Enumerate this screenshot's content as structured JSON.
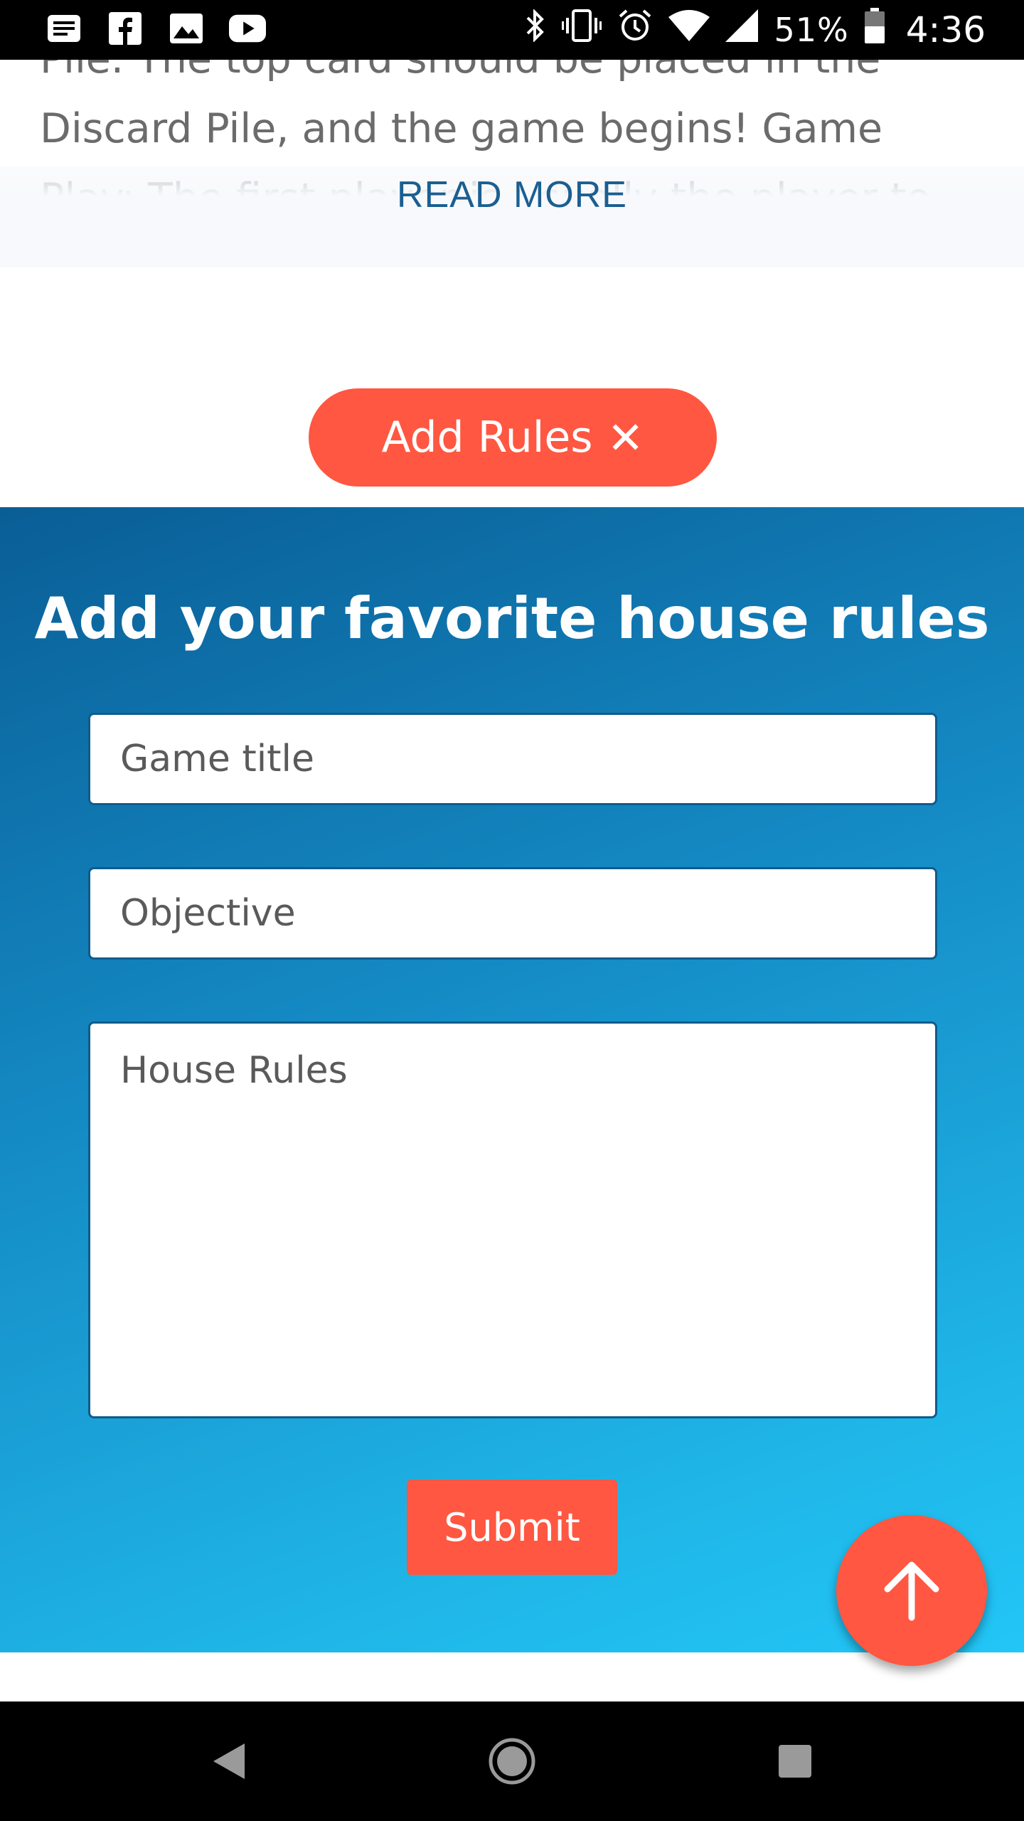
{
  "status_bar": {
    "left_icons": [
      "notes-icon",
      "facebook-icon",
      "image-icon",
      "youtube-icon"
    ],
    "right_icons": [
      "bluetooth-icon",
      "vibrate-icon",
      "alarm-icon",
      "wifi-icon",
      "signal-icon",
      "battery-icon"
    ],
    "battery_percent": "51%",
    "time": "4:36"
  },
  "article": {
    "text": "Pile. The top card should be placed in the Discard Pile, and the game begins! Game Play: The first player is usually the player to the left",
    "read_more_label": "READ MORE"
  },
  "add_rules_button": {
    "label": "Add Rules",
    "close_glyph": "✕"
  },
  "form": {
    "title": "Add your favorite house rules",
    "game_title_placeholder": "Game title",
    "objective_placeholder": "Objective",
    "house_rules_placeholder": "House Rules",
    "submit_label": "Submit"
  },
  "colors": {
    "accent": "#ff5741",
    "link": "#1a5f91",
    "gradient_start": "#0a5e96",
    "gradient_end": "#22c6f7"
  },
  "navigation": {
    "icons": [
      "back-icon",
      "home-icon",
      "recents-icon"
    ]
  }
}
